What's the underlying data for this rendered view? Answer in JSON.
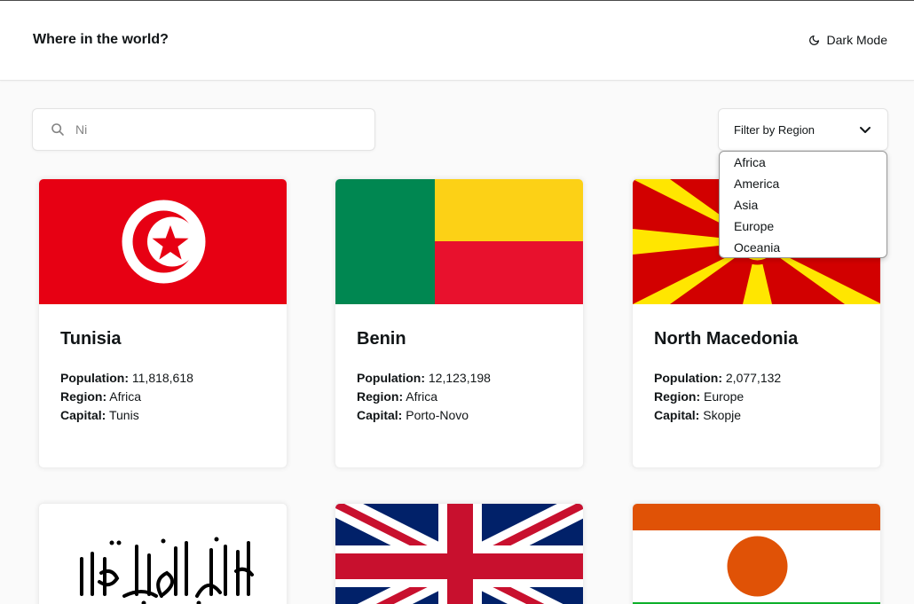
{
  "header": {
    "title": "Where in the world?",
    "mode_label": "Dark Mode"
  },
  "search": {
    "value": "Ni",
    "icon": "search-icon"
  },
  "filter": {
    "label": "Filter by Region",
    "options": [
      "Africa",
      "America",
      "Asia",
      "Europe",
      "Oceania"
    ]
  },
  "field_labels": {
    "population": "Population:",
    "region": "Region:",
    "capital": "Capital:"
  },
  "countries": [
    {
      "name": "Tunisia",
      "population": "11,818,618",
      "region": "Africa",
      "capital": "Tunis",
      "flag": "tunisia-flag"
    },
    {
      "name": "Benin",
      "population": "12,123,198",
      "region": "Africa",
      "capital": "Porto-Novo",
      "flag": "benin-flag"
    },
    {
      "name": "North Macedonia",
      "population": "2,077,132",
      "region": "Europe",
      "capital": "Skopje",
      "flag": "north-macedonia-flag"
    },
    {
      "flag": "afghanistan-flag"
    },
    {
      "flag": "united-kingdom-flag"
    },
    {
      "flag": "niger-flag"
    }
  ],
  "colors": {
    "background": "#fafafa",
    "element": "#ffffff",
    "text": "#111517"
  }
}
